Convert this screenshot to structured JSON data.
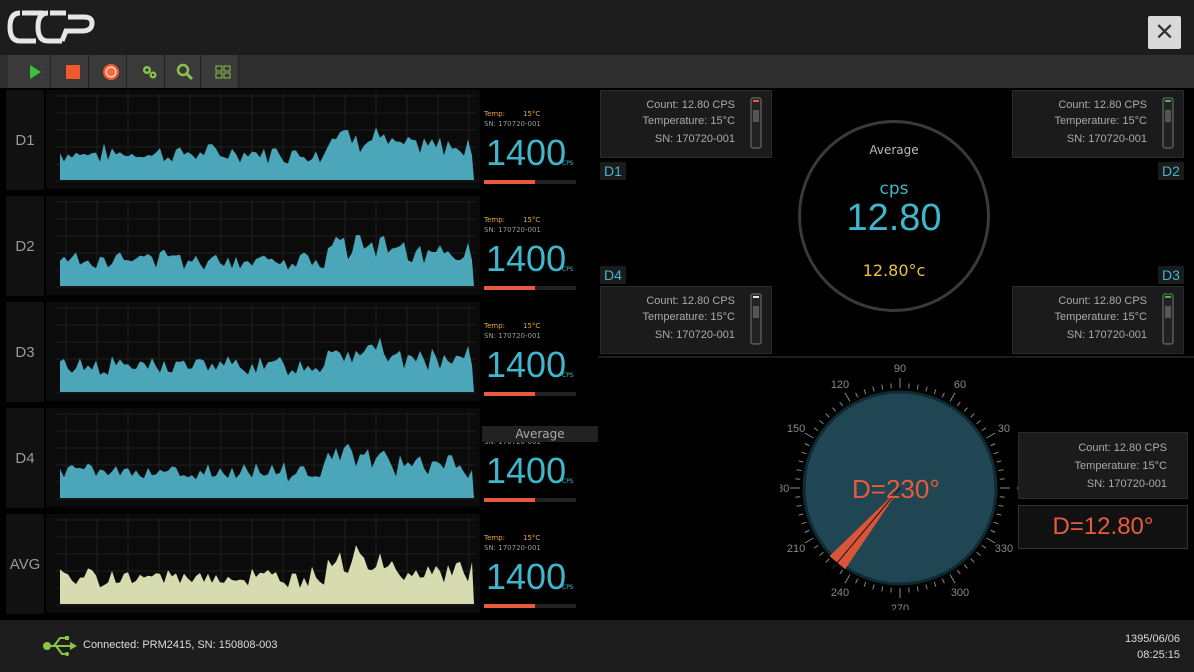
{
  "app": {
    "logo_text": "CCP"
  },
  "toolbar": {
    "buttons": [
      {
        "name": "play",
        "color": "#3cc13c"
      },
      {
        "name": "stop",
        "color": "#f05a2a"
      },
      {
        "name": "record",
        "color": "#f05a2a"
      },
      {
        "name": "settings",
        "color": "#8bc34a"
      },
      {
        "name": "zoom",
        "color": "#8bc34a"
      },
      {
        "name": "layout",
        "color": "#8bc34a"
      }
    ]
  },
  "rows": [
    {
      "label": "D1",
      "temp_label": "Temp:",
      "temp": "15°C",
      "sn": "SN: 170720-001",
      "value": "1400",
      "unit": "CPS",
      "level": 0.55
    },
    {
      "label": "D2",
      "temp_label": "Temp:",
      "temp": "15°C",
      "sn": "SN: 170720-001",
      "value": "1400",
      "unit": "CPS",
      "level": 0.55
    },
    {
      "label": "D3",
      "temp_label": "Temp:",
      "temp": "15°C",
      "sn": "SN: 170720-001",
      "value": "1400",
      "unit": "CPS",
      "level": 0.55
    },
    {
      "label": "D4",
      "temp_label": "Temp:",
      "temp": "15°C",
      "sn": "SN: 170720-001",
      "value": "1400",
      "unit": "CPS",
      "level": 0.55
    },
    {
      "label": "AVG",
      "temp_label": "Temp:",
      "temp": "15°C",
      "sn": "SN: 170720-001",
      "value": "1400",
      "unit": "CPS",
      "level": 0.55
    }
  ],
  "avg_row_title": "Average",
  "detectors": [
    {
      "tag": "D1",
      "count": "Count: 12.80 CPS",
      "temperature": "Temperature: 15°C",
      "sn": "SN: 170720-001"
    },
    {
      "tag": "D2",
      "count": "Count: 12.80 CPS",
      "temperature": "Temperature: 15°C",
      "sn": "SN: 170720-001"
    },
    {
      "tag": "D4",
      "count": "Count: 12.80 CPS",
      "temperature": "Temperature: 15°C",
      "sn": "SN: 170720-001"
    },
    {
      "tag": "D3",
      "count": "Count: 12.80 CPS",
      "temperature": "Temperature: 15°C",
      "sn": "SN: 170720-001"
    }
  ],
  "average": {
    "title": "Average",
    "unit": "cps",
    "value": "12.80",
    "temp": "12.80°c"
  },
  "direction": {
    "heading": "D=230°",
    "degrees": 230,
    "box_count": "Count: 12.80 CPS",
    "box_temperature": "Temperature: 15°C",
    "box_sn": "SN: 170720-001",
    "value": "D=12.80°",
    "ticks": [
      "0",
      "30",
      "60",
      "90",
      "120",
      "150",
      "180",
      "210",
      "240",
      "270",
      "300",
      "330"
    ]
  },
  "status": {
    "connection": "Connected: PRM2415, SN: 150808-003",
    "date": "1395/06/06",
    "time": "08:25:15"
  },
  "colors": {
    "accent": "#3fb6cc",
    "warning": "#e85a3c",
    "temp": "#e8c23c",
    "avg_fill": "#d6dcb0",
    "series_fill": "#4aa6b8"
  }
}
